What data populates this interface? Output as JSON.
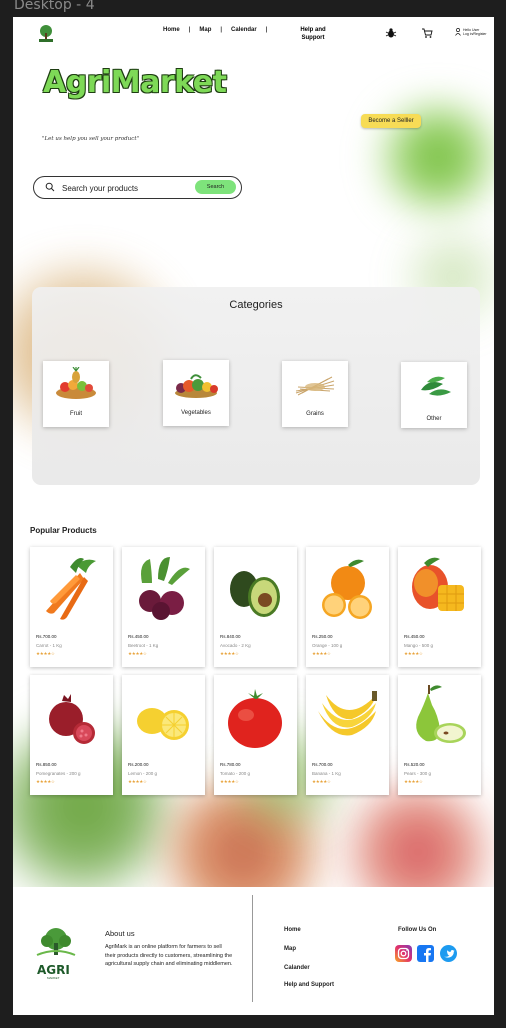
{
  "frame_label": "Desktop - 4",
  "nav": {
    "links": [
      "Home",
      "Map",
      "Calendar"
    ],
    "help": "Help and Support",
    "login_line1": "Hello User",
    "login_line2": "Log in/Register"
  },
  "hero": {
    "brand": "AgriMarket",
    "tagline": "\"Let us help you sell your product\"",
    "seller_button": "Become a Selller"
  },
  "search": {
    "placeholder": "Search your products",
    "button": "Search"
  },
  "categories": {
    "title": "Categories",
    "items": [
      {
        "label": "Fruit",
        "icon": "fruit-basket-icon"
      },
      {
        "label": "Vegetables",
        "icon": "vegetables-icon"
      },
      {
        "label": "Grains",
        "icon": "grains-icon"
      },
      {
        "label": "Other",
        "icon": "leaves-icon"
      }
    ]
  },
  "popular": {
    "title": "Popular Products",
    "products": [
      {
        "price": "Rs.700.00",
        "name": "Carrot - 1 Kg",
        "stars": "★★★★☆",
        "icon": "carrot-icon"
      },
      {
        "price": "Rs.450.00",
        "name": "Beetroot - 1 Kg",
        "stars": "★★★★☆",
        "icon": "beetroot-icon"
      },
      {
        "price": "Rs.840.00",
        "name": "Avocado - 2 Kg",
        "stars": "★★★★☆",
        "icon": "avocado-icon"
      },
      {
        "price": "Rs.250.00",
        "name": "Orange - 100 g",
        "stars": "★★★★☆",
        "icon": "orange-icon"
      },
      {
        "price": "Rs.450.00",
        "name": "Mango - 500 g",
        "stars": "★★★★☆",
        "icon": "mango-icon"
      },
      {
        "price": "Rs.850.00",
        "name": "Pomegranates - 200 g",
        "stars": "★★★★☆",
        "icon": "pomegranate-icon"
      },
      {
        "price": "Rs.200.00",
        "name": "Lemon - 200 g",
        "stars": "★★★★☆",
        "icon": "lemon-icon"
      },
      {
        "price": "Rs.780.00",
        "name": "Tomato - 200 g",
        "stars": "★★★★☆",
        "icon": "tomato-icon"
      },
      {
        "price": "Rs.700.00",
        "name": "Banana - 1 Kg",
        "stars": "★★★★☆",
        "icon": "banana-icon"
      },
      {
        "price": "Rs.520.00",
        "name": "Pears - 300 g",
        "stars": "★★★★☆",
        "icon": "pear-icon"
      }
    ]
  },
  "footer": {
    "logo_text": "AGRI",
    "logo_sub": "MARKET",
    "about_title": "About us",
    "about_text": "AgriMark is an online platform for farmers to sell their products directly to customers, streamlining the agricultural supply chain and eliminating middlemen.",
    "links": [
      "Home",
      "Map",
      "Calander",
      "Help and Support"
    ],
    "follow_title": "Follow Us On",
    "social": [
      "instagram-icon",
      "facebook-icon",
      "twitter-icon"
    ]
  },
  "colors": {
    "brand_green": "#7ed957",
    "seller_yellow": "#f7dc56",
    "search_green": "#7ee37b",
    "star_orange": "#e8a33a"
  }
}
